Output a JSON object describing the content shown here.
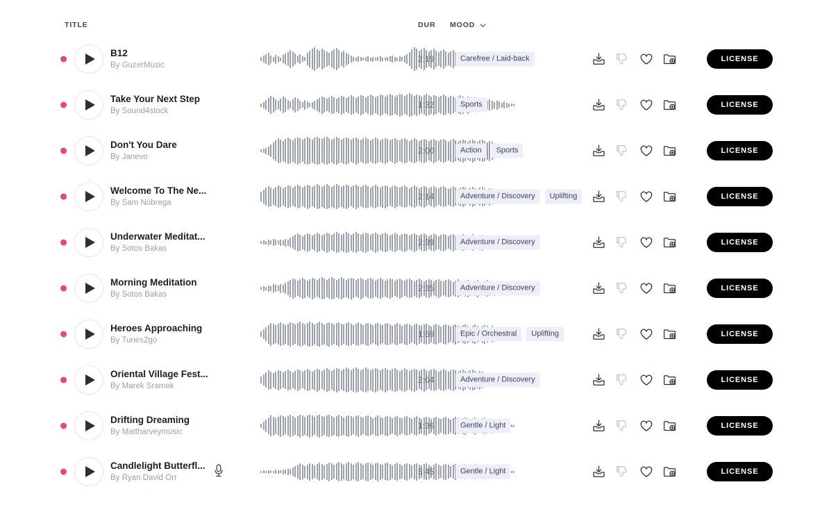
{
  "header": {
    "title_label": "TITLE",
    "dur_label": "DUR",
    "mood_label": "MOOD",
    "mood_chevron_icon": "chevron-down-icon"
  },
  "icons": {
    "download": "download-icon",
    "dislike": "thumbs-down-icon",
    "favorite": "heart-icon",
    "add_to_folder": "folder-add-icon",
    "play": "play-icon",
    "vocals": "microphone-icon",
    "status_dot": "status-dot-icon"
  },
  "colors": {
    "accent_dot": "#f2485f",
    "tag_background": "#eeeefb",
    "tag_text": "#3c4257",
    "waveform": "#9aa0ac",
    "license_button": "#000000",
    "title_text": "#1a1d24",
    "artist_text": "#9b9fa8"
  },
  "license_label": "LICENSE",
  "artist_prefix": "By ",
  "tracks": [
    {
      "title": "B12",
      "artist": "By GuzerMusic",
      "duration": "2:19",
      "moods": [
        "Carefree / Laid-back"
      ],
      "has_vocals": false,
      "waveform": [
        6,
        10,
        14,
        18,
        11,
        7,
        13,
        9,
        5,
        12,
        16,
        20,
        26,
        22,
        16,
        10,
        14,
        8,
        6,
        18,
        24,
        30,
        34,
        28,
        24,
        30,
        26,
        22,
        18,
        24,
        28,
        32,
        26,
        20,
        24,
        18,
        14,
        10,
        7,
        5,
        8,
        6,
        4,
        6,
        8,
        5,
        7,
        4,
        6,
        8,
        5,
        4,
        6,
        8,
        10,
        7,
        5,
        8,
        6,
        10,
        14,
        20,
        28,
        34,
        30,
        24,
        28,
        32,
        26,
        22,
        26,
        30,
        24,
        20,
        24,
        28,
        22,
        18,
        22,
        26,
        20,
        16,
        20,
        14,
        10,
        14,
        8,
        6,
        10,
        7,
        5,
        8,
        12,
        9,
        6,
        10,
        7,
        5,
        8,
        6,
        4,
        5,
        7,
        4,
        3
      ]
    },
    {
      "title": "Take Your Next Step",
      "artist": "By Sound4stock",
      "duration": "1:32",
      "moods": [
        "Sports"
      ],
      "has_vocals": false,
      "waveform": [
        5,
        9,
        14,
        20,
        26,
        22,
        16,
        12,
        18,
        24,
        20,
        14,
        10,
        16,
        22,
        18,
        12,
        8,
        14,
        10,
        6,
        9,
        13,
        17,
        21,
        25,
        22,
        18,
        22,
        26,
        23,
        19,
        23,
        27,
        24,
        20,
        24,
        28,
        25,
        21,
        25,
        29,
        26,
        22,
        26,
        30,
        27,
        23,
        27,
        31,
        28,
        24,
        28,
        32,
        29,
        25,
        29,
        33,
        30,
        26,
        30,
        34,
        31,
        27,
        31,
        28,
        24,
        28,
        32,
        29,
        25,
        29,
        26,
        22,
        26,
        30,
        27,
        23,
        27,
        24,
        20,
        24,
        28,
        25,
        21,
        25,
        22,
        18,
        22,
        19,
        15,
        19,
        16,
        12,
        16,
        13,
        9,
        13,
        10,
        7,
        10,
        7,
        5,
        4,
        3
      ]
    },
    {
      "title": "Don't You Dare",
      "artist": "By Janevo",
      "duration": "2:00",
      "moods": [
        "Action",
        "Sports"
      ],
      "has_vocals": false,
      "waveform": [
        4,
        6,
        9,
        13,
        18,
        24,
        30,
        36,
        33,
        29,
        34,
        38,
        35,
        31,
        36,
        39,
        36,
        32,
        37,
        40,
        37,
        33,
        38,
        40,
        37,
        34,
        38,
        40,
        36,
        33,
        37,
        40,
        36,
        33,
        37,
        39,
        36,
        32,
        36,
        39,
        35,
        32,
        36,
        38,
        35,
        31,
        35,
        38,
        34,
        31,
        35,
        37,
        34,
        30,
        34,
        37,
        33,
        30,
        34,
        36,
        33,
        29,
        33,
        36,
        32,
        29,
        33,
        35,
        32,
        28,
        32,
        35,
        31,
        28,
        32,
        34,
        31,
        27,
        31,
        34,
        30,
        27,
        31,
        33,
        30,
        26,
        30,
        33,
        29,
        26,
        30,
        32,
        29,
        25,
        29,
        26,
        22,
        19,
        15,
        12,
        9,
        7,
        5,
        4,
        3
      ]
    },
    {
      "title": "Welcome To The Ne...",
      "artist": "By Sam Nóbrega",
      "duration": "2:14",
      "moods": [
        "Adventure / Discovery",
        "Uplifting"
      ],
      "has_vocals": false,
      "waveform": [
        14,
        20,
        26,
        30,
        27,
        23,
        28,
        32,
        29,
        25,
        29,
        33,
        30,
        26,
        30,
        34,
        31,
        27,
        31,
        35,
        32,
        28,
        32,
        36,
        33,
        29,
        33,
        36,
        33,
        29,
        33,
        36,
        32,
        29,
        33,
        35,
        32,
        28,
        32,
        35,
        31,
        28,
        32,
        34,
        31,
        27,
        31,
        34,
        30,
        27,
        31,
        33,
        30,
        26,
        30,
        33,
        29,
        26,
        30,
        32,
        29,
        25,
        29,
        32,
        28,
        25,
        29,
        31,
        28,
        24,
        28,
        31,
        27,
        24,
        28,
        30,
        27,
        23,
        27,
        30,
        26,
        23,
        27,
        29,
        26,
        22,
        26,
        29,
        25,
        22,
        26,
        28,
        25,
        21,
        25,
        22,
        18,
        15,
        12,
        10,
        8,
        6,
        5,
        4,
        3
      ]
    },
    {
      "title": "Underwater Meditat...",
      "artist": "By Sotos Bakas",
      "duration": "2:39",
      "moods": [
        "Adventure / Discovery"
      ],
      "has_vocals": false,
      "waveform": [
        4,
        6,
        5,
        8,
        6,
        10,
        8,
        6,
        9,
        7,
        11,
        9,
        14,
        18,
        22,
        26,
        23,
        19,
        23,
        27,
        24,
        20,
        24,
        28,
        25,
        21,
        25,
        29,
        26,
        22,
        26,
        30,
        27,
        23,
        27,
        30,
        27,
        23,
        27,
        30,
        26,
        23,
        27,
        29,
        26,
        22,
        26,
        29,
        25,
        22,
        26,
        28,
        25,
        21,
        25,
        28,
        24,
        21,
        25,
        27,
        24,
        20,
        24,
        27,
        23,
        20,
        24,
        26,
        23,
        19,
        23,
        26,
        22,
        19,
        23,
        25,
        22,
        18,
        22,
        25,
        21,
        18,
        22,
        24,
        21,
        17,
        21,
        24,
        20,
        17,
        21,
        23,
        20,
        16,
        20,
        17,
        14,
        11,
        9,
        7,
        6,
        5,
        4,
        3,
        3
      ]
    },
    {
      "title": "Morning Meditation",
      "artist": "By Sotos Bakas",
      "duration": "2:35",
      "moods": [
        "Adventure / Discovery"
      ],
      "has_vocals": false,
      "waveform": [
        4,
        7,
        5,
        9,
        7,
        12,
        10,
        8,
        13,
        11,
        16,
        20,
        25,
        29,
        26,
        22,
        26,
        30,
        27,
        23,
        27,
        31,
        28,
        24,
        28,
        32,
        29,
        25,
        29,
        32,
        29,
        25,
        29,
        32,
        28,
        25,
        29,
        31,
        28,
        24,
        28,
        31,
        27,
        24,
        28,
        30,
        27,
        23,
        27,
        30,
        26,
        23,
        27,
        29,
        26,
        22,
        26,
        29,
        25,
        22,
        26,
        28,
        25,
        21,
        25,
        28,
        24,
        21,
        25,
        27,
        24,
        20,
        24,
        27,
        23,
        20,
        24,
        26,
        23,
        19,
        23,
        26,
        22,
        19,
        23,
        25,
        22,
        18,
        22,
        25,
        21,
        18,
        22,
        24,
        21,
        17,
        21,
        18,
        15,
        12,
        9,
        7,
        6,
        5,
        4
      ]
    },
    {
      "title": "Heroes Approaching",
      "artist": "By Tunes2go",
      "duration": "1:59",
      "moods": [
        "Epic / Orchestral",
        "Uplifting"
      ],
      "has_vocals": false,
      "waveform": [
        8,
        14,
        20,
        27,
        33,
        30,
        26,
        30,
        34,
        31,
        27,
        31,
        35,
        32,
        28,
        32,
        36,
        33,
        29,
        33,
        36,
        33,
        29,
        33,
        36,
        32,
        29,
        33,
        35,
        32,
        28,
        32,
        35,
        31,
        28,
        32,
        34,
        31,
        27,
        31,
        34,
        30,
        27,
        31,
        33,
        30,
        26,
        30,
        33,
        29,
        26,
        30,
        32,
        29,
        25,
        29,
        32,
        28,
        25,
        29,
        31,
        28,
        24,
        28,
        31,
        27,
        24,
        28,
        30,
        27,
        23,
        27,
        30,
        26,
        23,
        27,
        29,
        26,
        22,
        26,
        29,
        25,
        22,
        26,
        28,
        25,
        21,
        25,
        28,
        24,
        21,
        25,
        27,
        24,
        20,
        24,
        21,
        17,
        14,
        11,
        9,
        7,
        6,
        5,
        4
      ]
    },
    {
      "title": "Oriental Village Fest...",
      "artist": "By Marek Sramek",
      "duration": "2:04",
      "moods": [
        "Adventure / Discovery"
      ],
      "has_vocals": false,
      "waveform": [
        10,
        16,
        22,
        28,
        25,
        21,
        25,
        29,
        26,
        22,
        26,
        30,
        27,
        23,
        27,
        31,
        28,
        24,
        28,
        32,
        29,
        25,
        29,
        33,
        30,
        26,
        30,
        34,
        31,
        27,
        31,
        35,
        32,
        28,
        32,
        36,
        33,
        29,
        33,
        36,
        33,
        29,
        33,
        36,
        32,
        29,
        33,
        35,
        32,
        28,
        32,
        35,
        31,
        28,
        32,
        34,
        31,
        27,
        31,
        34,
        30,
        27,
        31,
        33,
        30,
        26,
        30,
        33,
        29,
        26,
        30,
        32,
        29,
        25,
        29,
        32,
        28,
        25,
        29,
        31,
        28,
        24,
        28,
        31,
        27,
        24,
        28,
        30,
        27,
        23,
        27,
        24,
        20,
        17,
        14,
        11,
        9,
        7,
        6,
        5,
        4
      ]
    },
    {
      "title": "Drifting Dreaming",
      "artist": "By Mattharveymusic",
      "duration": "1:36",
      "moods": [
        "Gentle / Light"
      ],
      "has_vocals": false,
      "waveform": [
        6,
        12,
        18,
        24,
        30,
        27,
        23,
        27,
        31,
        28,
        24,
        28,
        32,
        29,
        25,
        29,
        33,
        30,
        26,
        30,
        33,
        30,
        26,
        30,
        33,
        29,
        26,
        30,
        32,
        29,
        25,
        29,
        32,
        28,
        25,
        29,
        31,
        28,
        24,
        28,
        31,
        27,
        24,
        28,
        30,
        27,
        23,
        27,
        30,
        26,
        23,
        27,
        29,
        26,
        22,
        26,
        29,
        25,
        22,
        26,
        28,
        25,
        21,
        25,
        28,
        24,
        21,
        25,
        27,
        24,
        20,
        24,
        27,
        23,
        20,
        24,
        26,
        23,
        19,
        23,
        26,
        22,
        19,
        23,
        25,
        22,
        18,
        22,
        25,
        21,
        18,
        22,
        24,
        21,
        17,
        21,
        18,
        15,
        12,
        9,
        7,
        6,
        5,
        4,
        3
      ]
    },
    {
      "title": "Candlelight Butterfl...",
      "artist": "By Ryan David Orr",
      "duration": "5:45",
      "moods": [
        "Gentle / Light"
      ],
      "has_vocals": true,
      "waveform": [
        3,
        4,
        3,
        5,
        4,
        3,
        6,
        5,
        4,
        7,
        6,
        9,
        8,
        12,
        16,
        20,
        24,
        21,
        17,
        21,
        25,
        22,
        18,
        22,
        26,
        23,
        19,
        23,
        27,
        24,
        20,
        24,
        28,
        25,
        21,
        25,
        28,
        25,
        21,
        25,
        28,
        24,
        21,
        25,
        27,
        24,
        20,
        24,
        27,
        23,
        20,
        24,
        26,
        23,
        19,
        23,
        26,
        22,
        19,
        23,
        25,
        22,
        18,
        22,
        25,
        21,
        18,
        22,
        24,
        21,
        17,
        21,
        24,
        20,
        17,
        21,
        23,
        20,
        16,
        20,
        23,
        19,
        16,
        20,
        22,
        19,
        15,
        19,
        22,
        18,
        15,
        19,
        21,
        18,
        14,
        18,
        15,
        12,
        10,
        8,
        6,
        5,
        4,
        3,
        3
      ]
    }
  ]
}
